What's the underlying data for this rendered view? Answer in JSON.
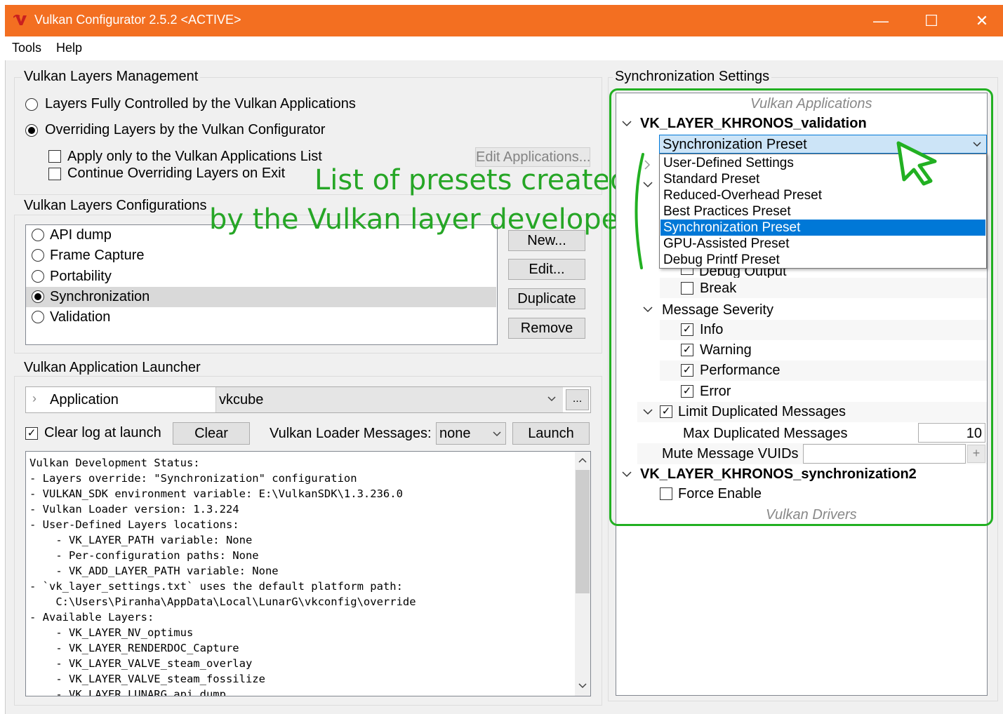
{
  "window": {
    "title": "Vulkan Configurator 2.5.2 <ACTIVE>",
    "minimize": "—",
    "maximize": "☐",
    "close": "✕",
    "accent": "#f36f21"
  },
  "menu": {
    "tools": "Tools",
    "help": "Help"
  },
  "layers_management": {
    "title": "Vulkan Layers Management",
    "radio_apps": "Layers Fully Controlled by the Vulkan Applications",
    "radio_configurator": "Overriding Layers by the Vulkan Configurator",
    "check_apply_list": "Apply only to the Vulkan Applications List",
    "check_continue": "Continue Overriding Layers on Exit",
    "edit_applications": "Edit Applications..."
  },
  "annotation": {
    "line1": "List of presets created",
    "line2": "by the Vulkan layer developers",
    "color": "#26a626"
  },
  "layers_configurations": {
    "title": "Vulkan Layers Configurations",
    "items": [
      "API dump",
      "Frame Capture",
      "Portability",
      "Synchronization",
      "Validation"
    ],
    "selected": "Synchronization",
    "buttons": {
      "new": "New...",
      "edit": "Edit...",
      "duplicate": "Duplicate",
      "remove": "Remove"
    }
  },
  "launcher": {
    "title": "Vulkan Application Launcher",
    "application_label": "Application",
    "application_value": "vkcube",
    "browse": "...",
    "clear_log_label": "Clear log at launch",
    "clear_button": "Clear",
    "loader_messages_label": "Vulkan Loader Messages:",
    "loader_messages_value": "none",
    "launch_button": "Launch"
  },
  "log": {
    "lines": [
      "Vulkan Development Status:",
      "- Layers override: \"Synchronization\" configuration",
      "- VULKAN_SDK environment variable: E:\\VulkanSDK\\1.3.236.0",
      "- Vulkan Loader version: 1.3.224",
      "- User-Defined Layers locations:",
      "    - VK_LAYER_PATH variable: None",
      "    - Per-configuration paths: None",
      "    - VK_ADD_LAYER_PATH variable: None",
      "- `vk_layer_settings.txt` uses the default platform path:",
      "    C:\\Users\\Piranha\\AppData\\Local\\LunarG\\vkconfig\\override",
      "- Available Layers:",
      "    - VK_LAYER_NV_optimus",
      "    - VK_LAYER_RENDERDOC_Capture",
      "    - VK_LAYER_VALVE_steam_overlay",
      "    - VK_LAYER_VALVE_steam_fossilize",
      "    - VK_LAYER_LUNARG_api_dump"
    ]
  },
  "sync_settings": {
    "title": "Synchronization Settings",
    "vulkan_applications": "Vulkan Applications",
    "layer_validation": "VK_LAYER_KHRONOS_validation",
    "preset_selected": "Synchronization Preset",
    "presets": [
      "User-Defined Settings",
      "Standard Preset",
      "Reduced-Overhead Preset",
      "Best Practices Preset",
      "Synchronization Preset",
      "GPU-Assisted Preset",
      "Debug Printf Preset"
    ],
    "hidden_debug_output": "Debug Output",
    "break_label": "Break",
    "message_severity": "Message Severity",
    "severity": [
      "Info",
      "Warning",
      "Performance",
      "Error"
    ],
    "limit_duplicated": "Limit Duplicated Messages",
    "max_duplicated_label": "Max Duplicated Messages",
    "max_duplicated_value": "10",
    "mute_vuids_label": "Mute Message VUIDs",
    "mute_add": "+",
    "layer_sync2": "VK_LAYER_KHRONOS_synchronization2",
    "force_enable": "Force Enable",
    "vulkan_drivers": "Vulkan Drivers"
  }
}
